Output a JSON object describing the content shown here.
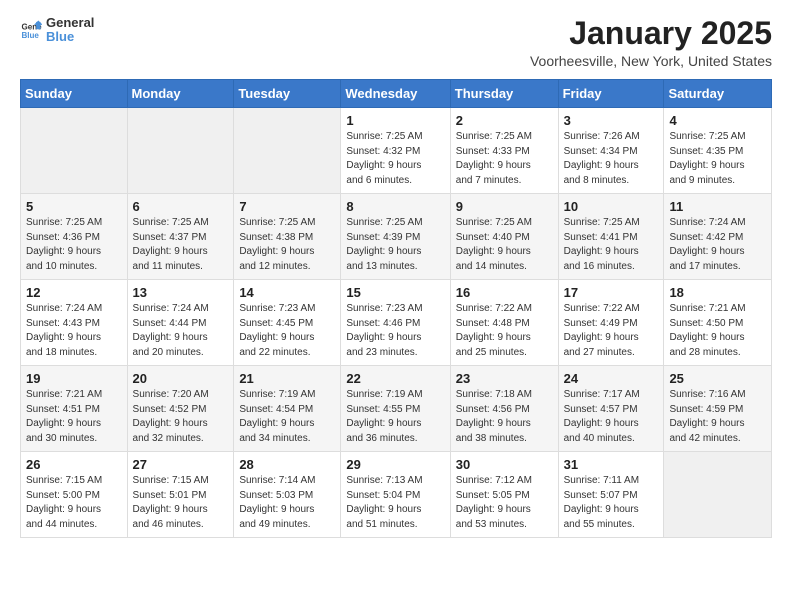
{
  "header": {
    "logo_general": "General",
    "logo_blue": "Blue",
    "month_year": "January 2025",
    "location": "Voorheesville, New York, United States"
  },
  "weekdays": [
    "Sunday",
    "Monday",
    "Tuesday",
    "Wednesday",
    "Thursday",
    "Friday",
    "Saturday"
  ],
  "weeks": [
    [
      {
        "day": "",
        "info": ""
      },
      {
        "day": "",
        "info": ""
      },
      {
        "day": "",
        "info": ""
      },
      {
        "day": "1",
        "info": "Sunrise: 7:25 AM\nSunset: 4:32 PM\nDaylight: 9 hours\nand 6 minutes."
      },
      {
        "day": "2",
        "info": "Sunrise: 7:25 AM\nSunset: 4:33 PM\nDaylight: 9 hours\nand 7 minutes."
      },
      {
        "day": "3",
        "info": "Sunrise: 7:26 AM\nSunset: 4:34 PM\nDaylight: 9 hours\nand 8 minutes."
      },
      {
        "day": "4",
        "info": "Sunrise: 7:25 AM\nSunset: 4:35 PM\nDaylight: 9 hours\nand 9 minutes."
      }
    ],
    [
      {
        "day": "5",
        "info": "Sunrise: 7:25 AM\nSunset: 4:36 PM\nDaylight: 9 hours\nand 10 minutes."
      },
      {
        "day": "6",
        "info": "Sunrise: 7:25 AM\nSunset: 4:37 PM\nDaylight: 9 hours\nand 11 minutes."
      },
      {
        "day": "7",
        "info": "Sunrise: 7:25 AM\nSunset: 4:38 PM\nDaylight: 9 hours\nand 12 minutes."
      },
      {
        "day": "8",
        "info": "Sunrise: 7:25 AM\nSunset: 4:39 PM\nDaylight: 9 hours\nand 13 minutes."
      },
      {
        "day": "9",
        "info": "Sunrise: 7:25 AM\nSunset: 4:40 PM\nDaylight: 9 hours\nand 14 minutes."
      },
      {
        "day": "10",
        "info": "Sunrise: 7:25 AM\nSunset: 4:41 PM\nDaylight: 9 hours\nand 16 minutes."
      },
      {
        "day": "11",
        "info": "Sunrise: 7:24 AM\nSunset: 4:42 PM\nDaylight: 9 hours\nand 17 minutes."
      }
    ],
    [
      {
        "day": "12",
        "info": "Sunrise: 7:24 AM\nSunset: 4:43 PM\nDaylight: 9 hours\nand 18 minutes."
      },
      {
        "day": "13",
        "info": "Sunrise: 7:24 AM\nSunset: 4:44 PM\nDaylight: 9 hours\nand 20 minutes."
      },
      {
        "day": "14",
        "info": "Sunrise: 7:23 AM\nSunset: 4:45 PM\nDaylight: 9 hours\nand 22 minutes."
      },
      {
        "day": "15",
        "info": "Sunrise: 7:23 AM\nSunset: 4:46 PM\nDaylight: 9 hours\nand 23 minutes."
      },
      {
        "day": "16",
        "info": "Sunrise: 7:22 AM\nSunset: 4:48 PM\nDaylight: 9 hours\nand 25 minutes."
      },
      {
        "day": "17",
        "info": "Sunrise: 7:22 AM\nSunset: 4:49 PM\nDaylight: 9 hours\nand 27 minutes."
      },
      {
        "day": "18",
        "info": "Sunrise: 7:21 AM\nSunset: 4:50 PM\nDaylight: 9 hours\nand 28 minutes."
      }
    ],
    [
      {
        "day": "19",
        "info": "Sunrise: 7:21 AM\nSunset: 4:51 PM\nDaylight: 9 hours\nand 30 minutes."
      },
      {
        "day": "20",
        "info": "Sunrise: 7:20 AM\nSunset: 4:52 PM\nDaylight: 9 hours\nand 32 minutes."
      },
      {
        "day": "21",
        "info": "Sunrise: 7:19 AM\nSunset: 4:54 PM\nDaylight: 9 hours\nand 34 minutes."
      },
      {
        "day": "22",
        "info": "Sunrise: 7:19 AM\nSunset: 4:55 PM\nDaylight: 9 hours\nand 36 minutes."
      },
      {
        "day": "23",
        "info": "Sunrise: 7:18 AM\nSunset: 4:56 PM\nDaylight: 9 hours\nand 38 minutes."
      },
      {
        "day": "24",
        "info": "Sunrise: 7:17 AM\nSunset: 4:57 PM\nDaylight: 9 hours\nand 40 minutes."
      },
      {
        "day": "25",
        "info": "Sunrise: 7:16 AM\nSunset: 4:59 PM\nDaylight: 9 hours\nand 42 minutes."
      }
    ],
    [
      {
        "day": "26",
        "info": "Sunrise: 7:15 AM\nSunset: 5:00 PM\nDaylight: 9 hours\nand 44 minutes."
      },
      {
        "day": "27",
        "info": "Sunrise: 7:15 AM\nSunset: 5:01 PM\nDaylight: 9 hours\nand 46 minutes."
      },
      {
        "day": "28",
        "info": "Sunrise: 7:14 AM\nSunset: 5:03 PM\nDaylight: 9 hours\nand 49 minutes."
      },
      {
        "day": "29",
        "info": "Sunrise: 7:13 AM\nSunset: 5:04 PM\nDaylight: 9 hours\nand 51 minutes."
      },
      {
        "day": "30",
        "info": "Sunrise: 7:12 AM\nSunset: 5:05 PM\nDaylight: 9 hours\nand 53 minutes."
      },
      {
        "day": "31",
        "info": "Sunrise: 7:11 AM\nSunset: 5:07 PM\nDaylight: 9 hours\nand 55 minutes."
      },
      {
        "day": "",
        "info": ""
      }
    ]
  ]
}
